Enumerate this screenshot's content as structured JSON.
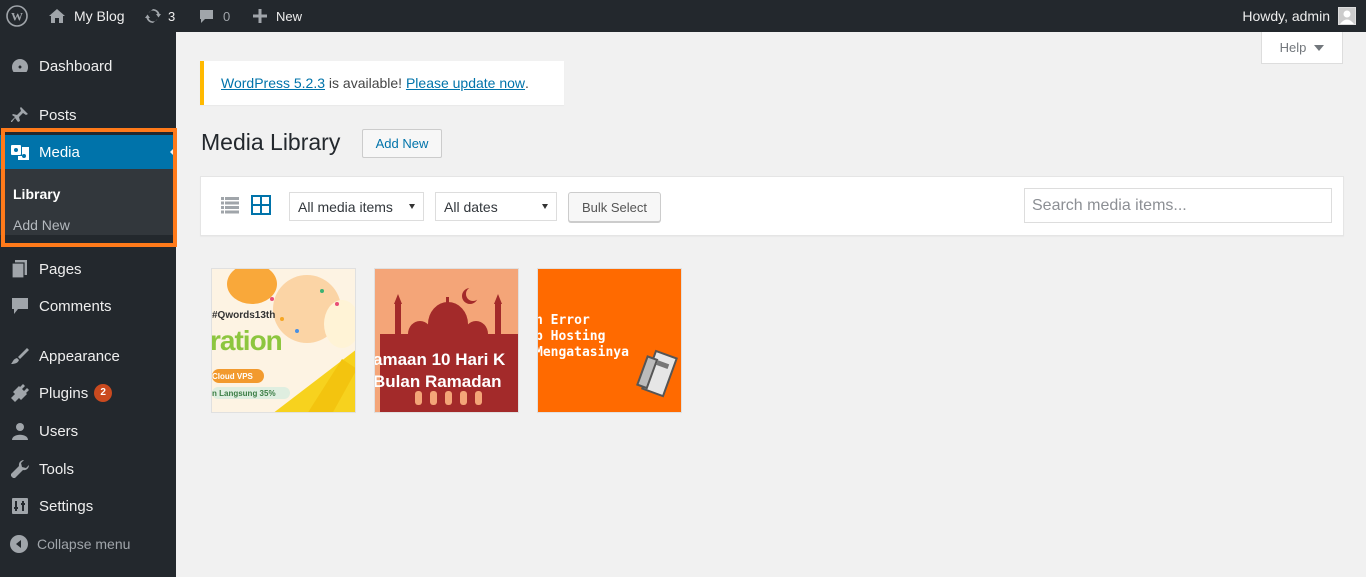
{
  "adminbar": {
    "site_name": "My Blog",
    "updates_count": "3",
    "comments_count": "0",
    "new_label": "New",
    "howdy": "Howdy, admin"
  },
  "sidebar": {
    "dashboard": "Dashboard",
    "posts": "Posts",
    "media": "Media",
    "library": "Library",
    "add_new": "Add New",
    "pages": "Pages",
    "comments": "Comments",
    "appearance": "Appearance",
    "plugins": "Plugins",
    "plugins_badge": "2",
    "users": "Users",
    "tools": "Tools",
    "settings": "Settings",
    "collapse": "Collapse menu"
  },
  "help": {
    "label": "Help"
  },
  "notice": {
    "link1": "WordPress 5.2.3",
    "middle": " is available! ",
    "link2": "Please update now",
    "end": "."
  },
  "page": {
    "title": "Media Library",
    "add_new": "Add New"
  },
  "toolbar": {
    "filter_type": "All media items",
    "filter_date": "All dates",
    "bulk_select": "Bulk Select",
    "search_placeholder": "Search media items..."
  },
  "media": [
    {
      "lines": [
        "#Qwords13th",
        "ration",
        "Cloud VPS",
        "n Langsung 35%"
      ]
    },
    {
      "lines": [
        "amaan 10 Hari K",
        "Bulan Ramadan"
      ]
    },
    {
      "lines": [
        "n Error",
        "b Hosting",
        "Mengatasinya"
      ]
    }
  ],
  "colors": {
    "adminbar": "#23282d",
    "sidebar": "#23282d",
    "active": "#0073aa",
    "highlight": "#ff7a1a",
    "notice_border": "#ffb900",
    "link": "#0073aa"
  }
}
